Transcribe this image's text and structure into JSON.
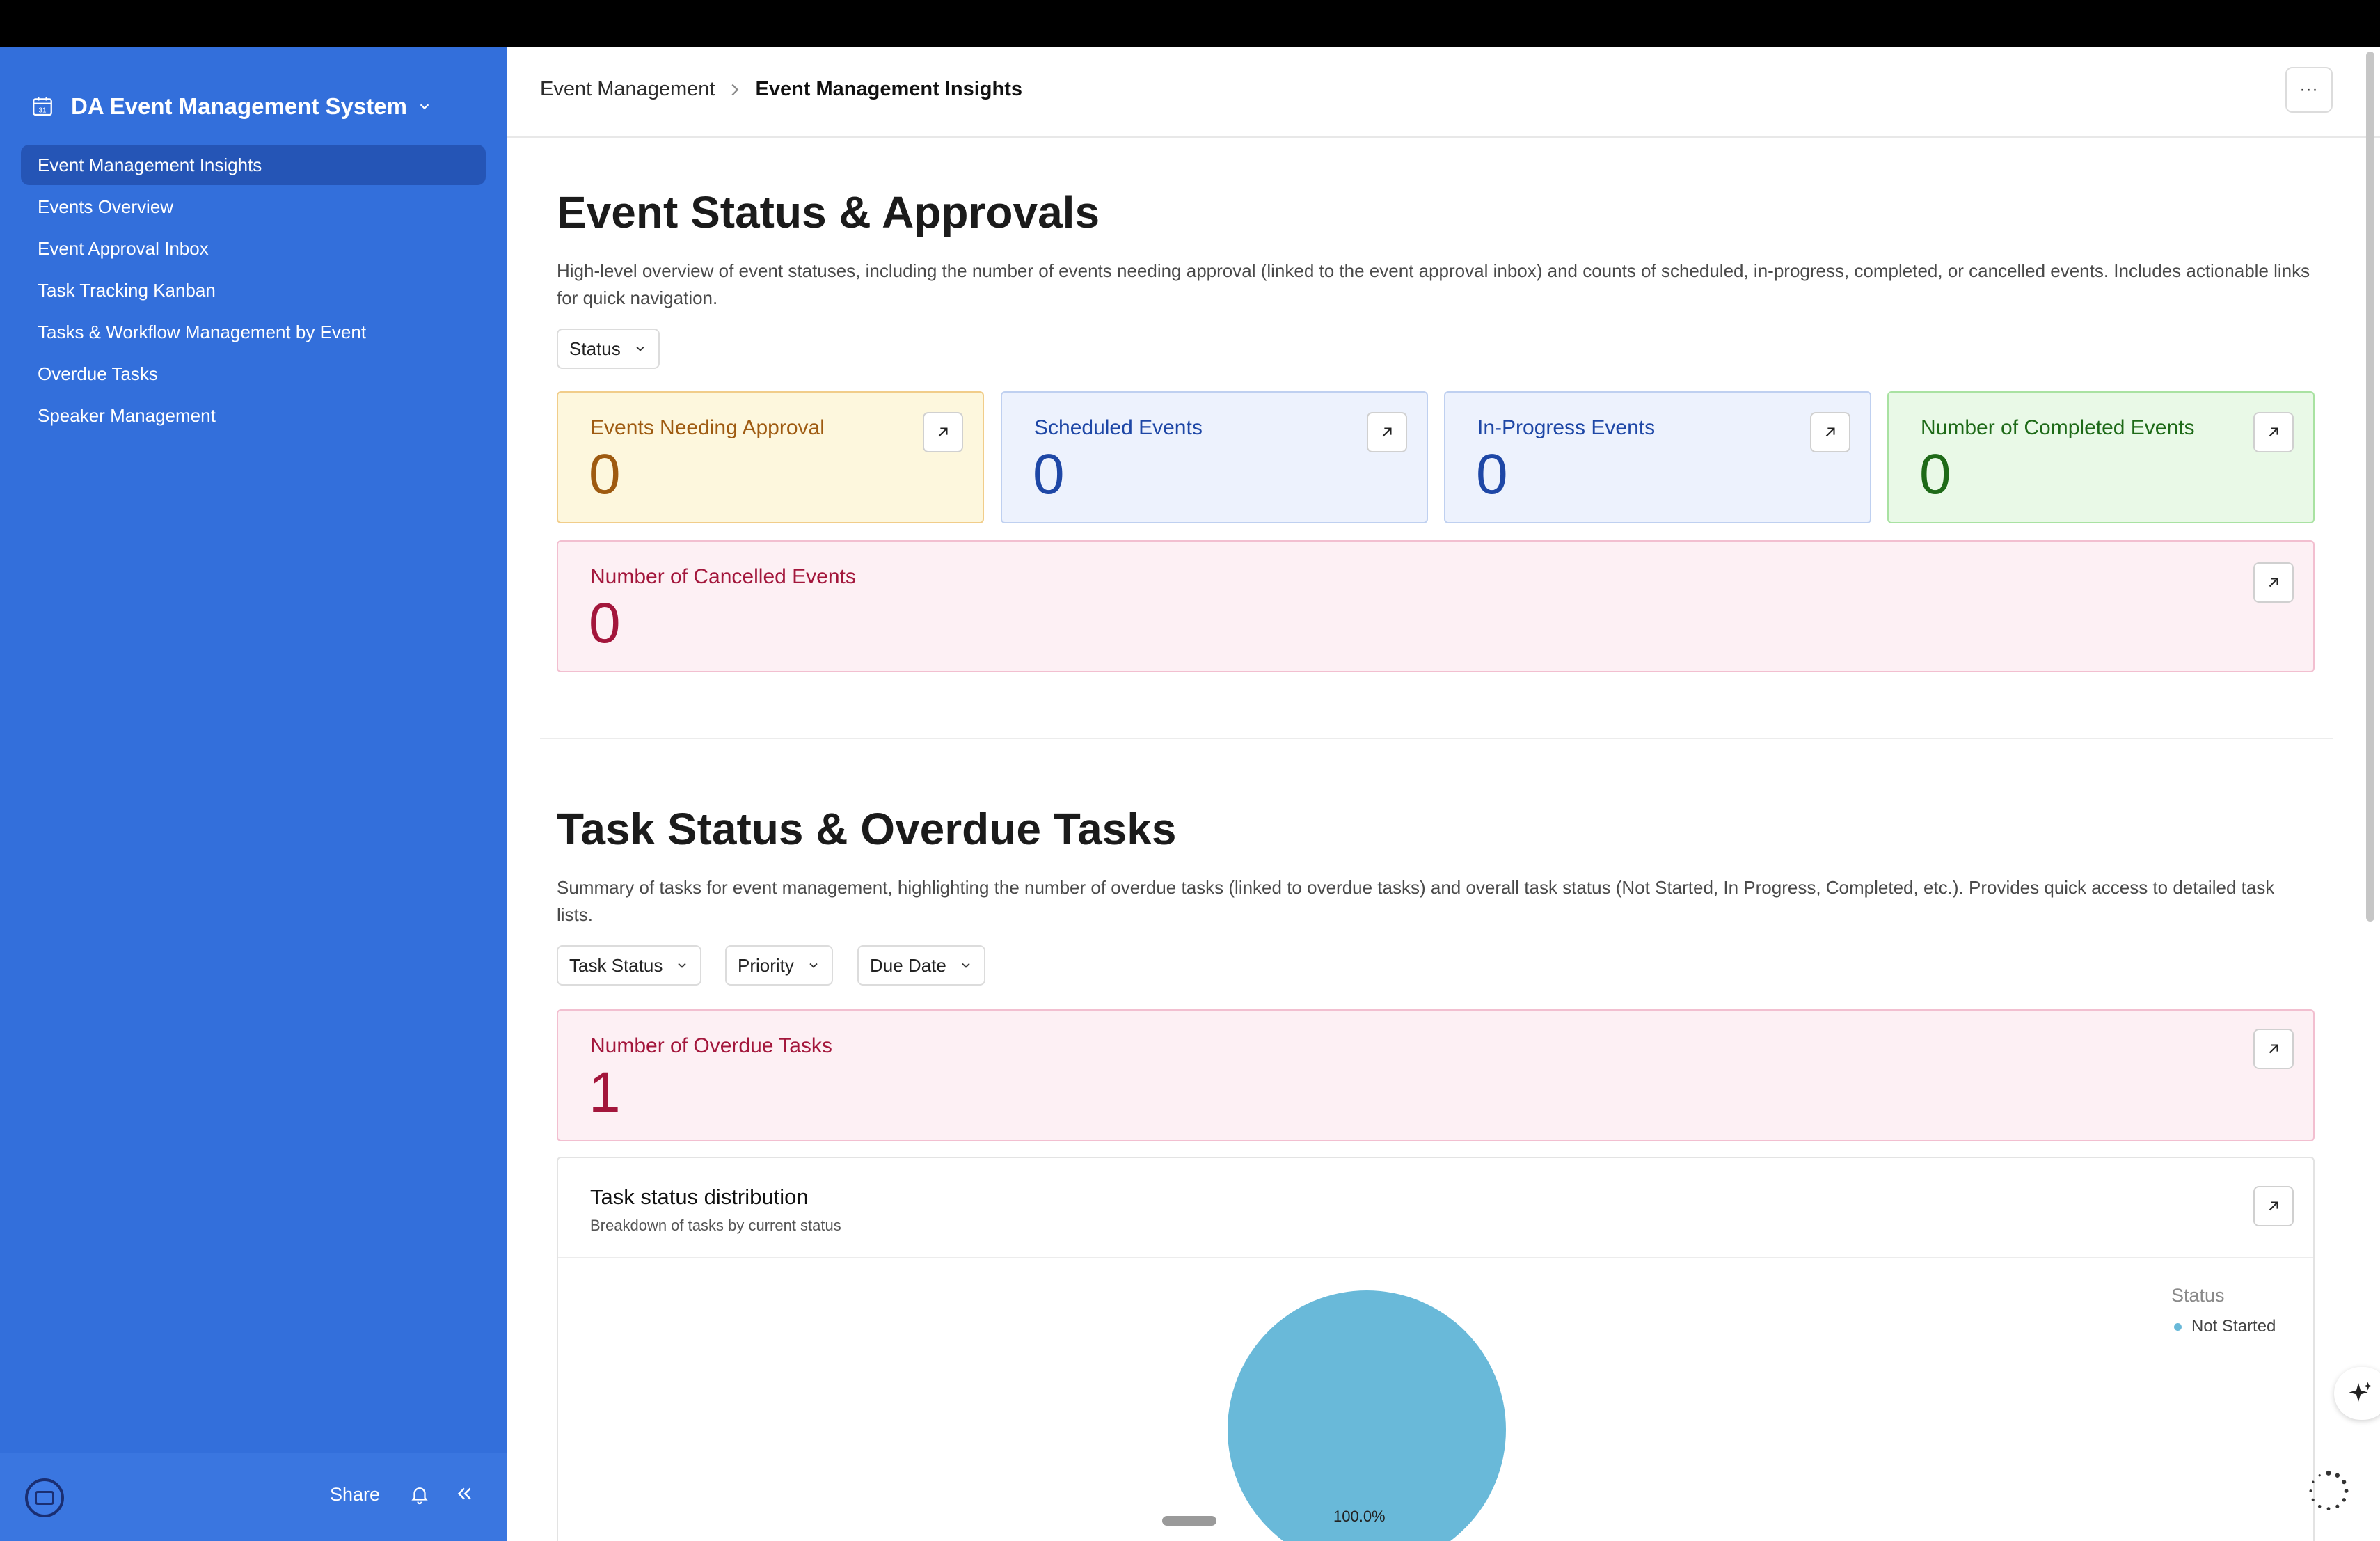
{
  "app": {
    "title": "DA Event Management System",
    "icon": "calendar-icon"
  },
  "sidebar": {
    "items": [
      {
        "label": "Event Management Insights",
        "active": true
      },
      {
        "label": "Events Overview",
        "active": false
      },
      {
        "label": "Event Approval Inbox",
        "active": false
      },
      {
        "label": "Task Tracking Kanban",
        "active": false
      },
      {
        "label": "Tasks & Workflow Management by Event",
        "active": false
      },
      {
        "label": "Overdue Tasks",
        "active": false
      },
      {
        "label": "Speaker Management",
        "active": false
      }
    ],
    "footer": {
      "share_label": "Share"
    }
  },
  "breadcrumb": {
    "parent": "Event Management",
    "current": "Event Management Insights"
  },
  "more_label": "···",
  "sections": {
    "events": {
      "title": "Event Status & Approvals",
      "description": "High-level overview of event statuses, including the number of events needing approval (linked to the event approval inbox) and counts of scheduled, in-progress, completed, or cancelled events. Includes actionable links for quick navigation.",
      "filters": [
        "Status"
      ],
      "cards": [
        {
          "label": "Events Needing Approval",
          "value": "0",
          "color": "#9e5a10"
        },
        {
          "label": "Scheduled Events",
          "value": "0",
          "color": "#1e47a6"
        },
        {
          "label": "In-Progress Events",
          "value": "0",
          "color": "#1e47a6"
        },
        {
          "label": "Number of Completed Events",
          "value": "0",
          "color": "#1e6a18"
        },
        {
          "label": "Number of Cancelled Events",
          "value": "0",
          "color": "#a3163b"
        }
      ]
    },
    "tasks": {
      "title": "Task Status & Overdue Tasks",
      "description": "Summary of tasks for event management, highlighting the number of overdue tasks (linked to overdue tasks) and overall task status (Not Started, In Progress, Completed, etc.). Provides quick access to detailed task lists.",
      "filters": [
        "Task Status",
        "Priority",
        "Due Date"
      ],
      "overdue_card": {
        "label": "Number of Overdue Tasks",
        "value": "1",
        "color": "#a3163b"
      },
      "chart": {
        "title": "Task status distribution",
        "subtitle": "Breakdown of tasks by current status",
        "legend_title": "Status"
      }
    }
  },
  "chart_data": {
    "type": "pie",
    "title": "Task status distribution",
    "subtitle": "Breakdown of tasks by current status",
    "legend_title": "Status",
    "legend_position": "top-right",
    "slices": [
      {
        "label": "Not Started",
        "value": 100.0,
        "display": "100.0%",
        "color": "#69b9d9"
      }
    ]
  }
}
